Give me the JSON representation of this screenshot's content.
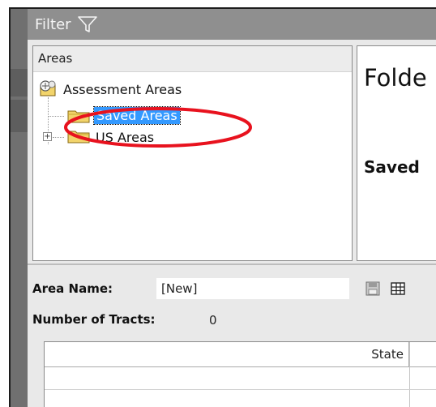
{
  "filter": {
    "label": "Filter",
    "icon": "funnel-icon"
  },
  "tree": {
    "header": "Areas",
    "root": {
      "label": "Assessment Areas",
      "icon": "assessment-areas-icon"
    },
    "children": [
      {
        "label": "Saved Areas",
        "icon": "folder-icon",
        "selected": true
      },
      {
        "label": "US Areas",
        "icon": "folder-icon",
        "expander": "+"
      }
    ]
  },
  "detail": {
    "title": "Folde",
    "subtitle": "Saved"
  },
  "form": {
    "area_name_label": "Area Name:",
    "area_name_value": "[New]",
    "tracts_label": "Number of Tracts:",
    "tracts_value": "0",
    "save_icon": "floppy-disk-icon",
    "grid_icon": "table-grid-icon"
  },
  "table": {
    "columns": [
      "State"
    ]
  },
  "colors": {
    "selection": "#3399ff",
    "annotation": "#e8121e",
    "folder": "#f2d46b"
  }
}
